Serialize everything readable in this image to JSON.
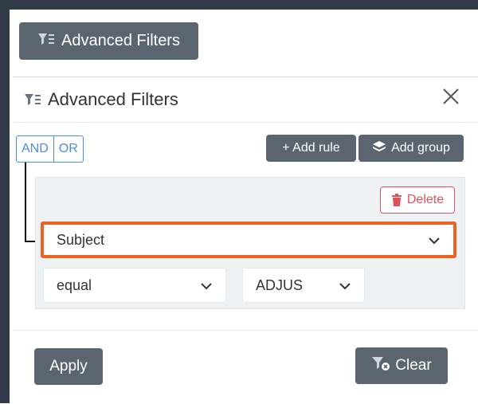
{
  "toolbar": {
    "open_button_label": "Advanced Filters"
  },
  "panel": {
    "title": "Advanced Filters",
    "conjunctions": {
      "and": "AND",
      "or": "OR"
    },
    "add_rule_label": "+ Add rule",
    "add_group_label": "Add group",
    "rule": {
      "delete_label": "Delete",
      "field_value": "Subject",
      "operator_value": "equal",
      "value_value": "ADJUS"
    },
    "footer": {
      "apply_label": "Apply",
      "clear_label": "Clear"
    }
  },
  "colors": {
    "dark_button": "#5b6570",
    "accent_blue": "#4a8fe0",
    "delete_red": "#e0525a",
    "highlight_orange": "#ea6321",
    "frame_dark": "#2f3b48"
  },
  "icons": [
    "filter-icon",
    "close-icon",
    "layers-icon",
    "trash-icon",
    "chevron-down-icon",
    "filter-clear-icon"
  ]
}
